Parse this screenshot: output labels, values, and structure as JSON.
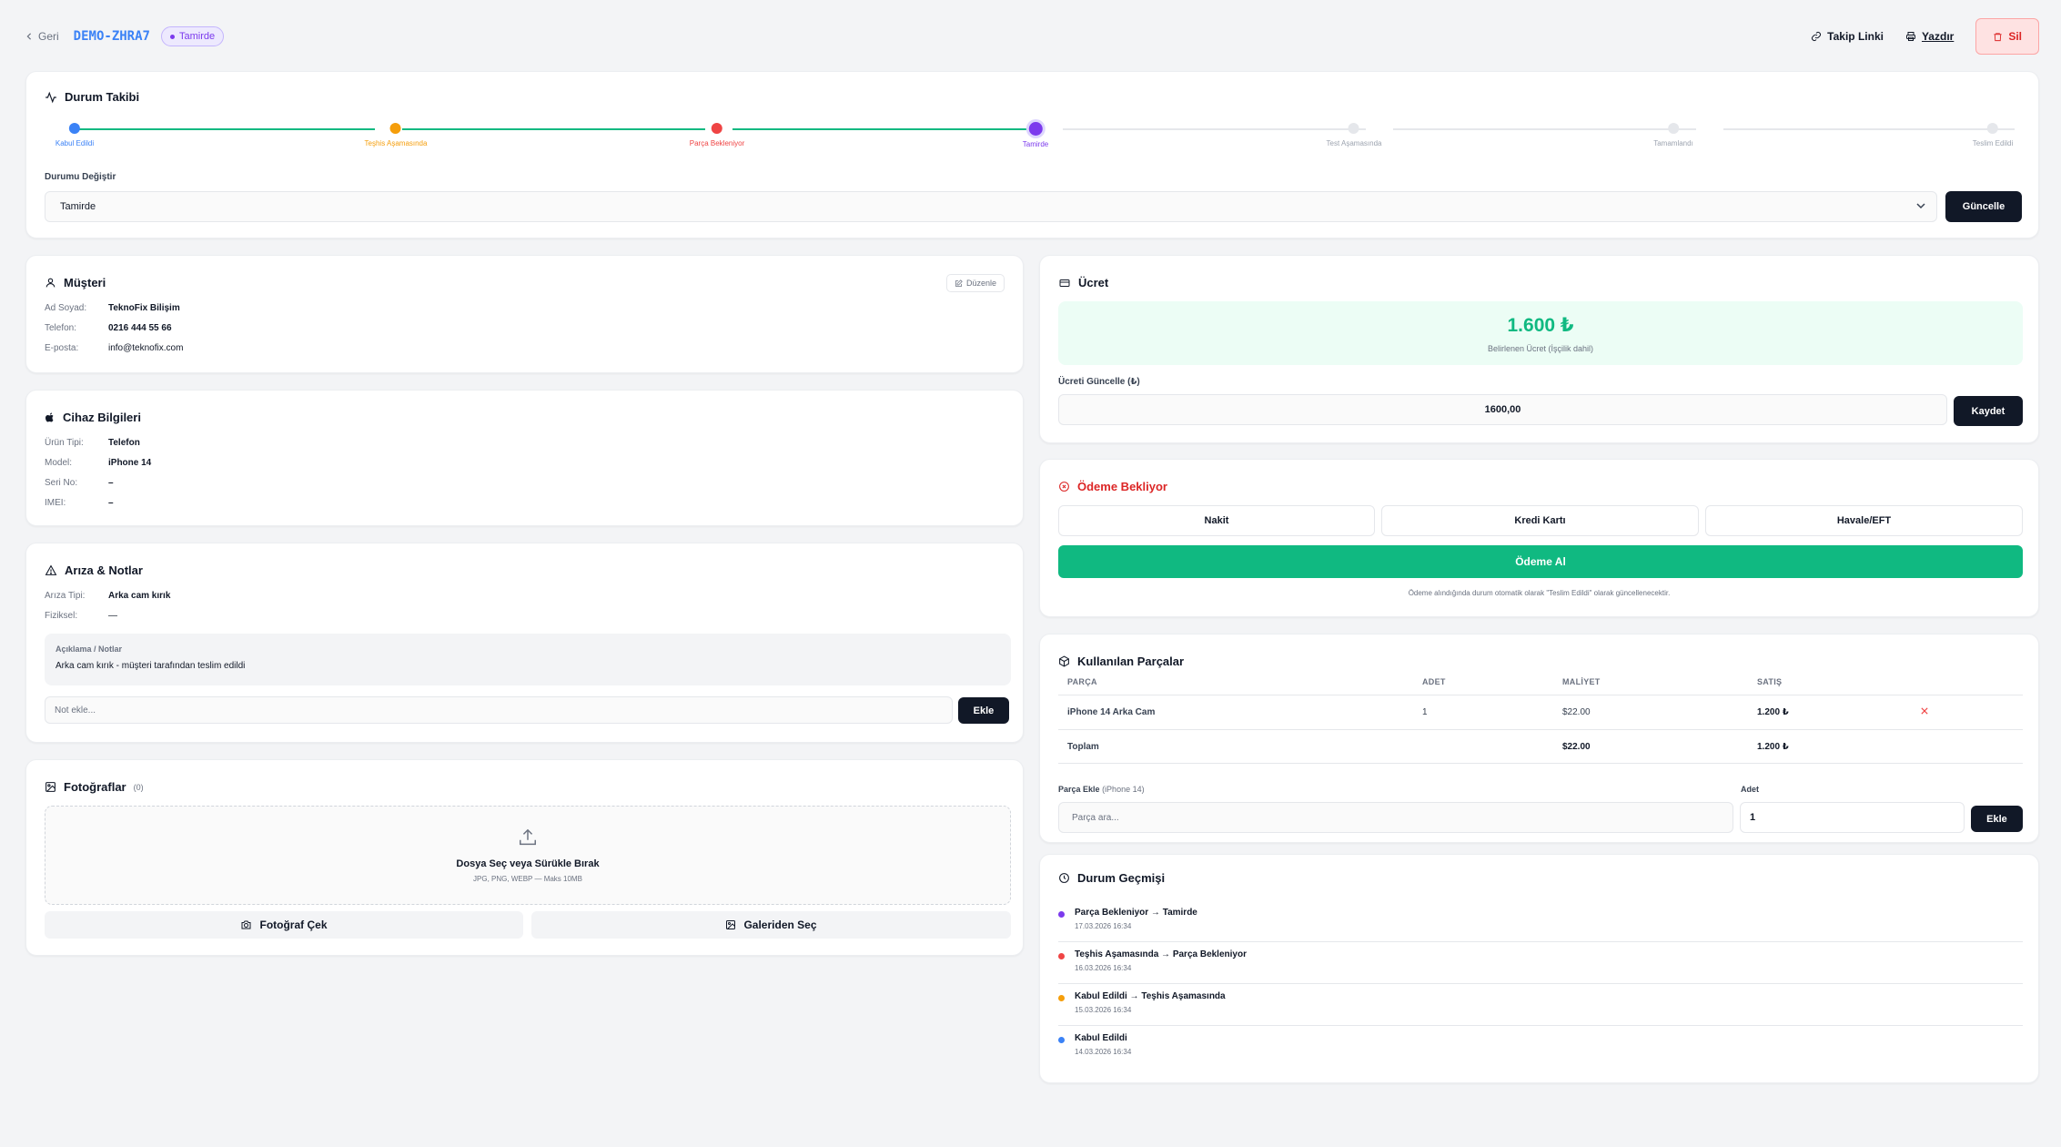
{
  "header": {
    "back_label": "Geri",
    "code": "DEMO-ZHRA7",
    "status_badge": "Tamirde",
    "tracking_link_label": "Takip Linki",
    "print_label": "Yazdır",
    "delete_label": "Sil"
  },
  "status_tracking": {
    "title": "Durum Takibi",
    "steps": [
      {
        "label": "Kabul Edildi",
        "color": "#3b82f6"
      },
      {
        "label": "Teşhis Aşamasında",
        "color": "#f59e0b"
      },
      {
        "label": "Parça Bekleniyor",
        "color": "#ef4444"
      },
      {
        "label": "Tamirde",
        "color": "#7c3aed"
      },
      {
        "label": "Test Aşamasında",
        "color": "#9ca3af"
      },
      {
        "label": "Tamamlandı",
        "color": "#9ca3af"
      },
      {
        "label": "Teslim Edildi",
        "color": "#9ca3af"
      }
    ],
    "change_label": "Durumu Değiştir",
    "selected_status": "Tamirde",
    "update_button": "Güncelle"
  },
  "customer": {
    "title": "Müşteri",
    "edit_label": "Düzenle",
    "fields": [
      {
        "key": "Ad Soyad:",
        "value": "TeknoFix Bilişim"
      },
      {
        "key": "Telefon:",
        "value": "0216 444 55 66"
      },
      {
        "key": "E-posta:",
        "value": "info@teknofix.com"
      }
    ]
  },
  "device": {
    "title": "Cihaz Bilgileri",
    "fields": [
      {
        "key": "Ürün Tipi:",
        "value": "Telefon"
      },
      {
        "key": "Model:",
        "value": "iPhone 14"
      },
      {
        "key": "Seri No:",
        "value": "–"
      },
      {
        "key": "IMEI:",
        "value": "–"
      }
    ]
  },
  "fault": {
    "title": "Arıza & Notlar",
    "fields": [
      {
        "key": "Arıza Tipi:",
        "value": "Arka cam kırık"
      },
      {
        "key": "Fiziksel:",
        "value": "—"
      }
    ],
    "notes_title": "Açıklama / Notlar",
    "notes_text": "Arka cam kırık - müşteri tarafından teslim edildi",
    "note_placeholder": "Not ekle...",
    "add_button": "Ekle"
  },
  "photos": {
    "title": "Fotoğraflar",
    "count": "(0)",
    "drop_title": "Dosya Seç veya Sürükle Bırak",
    "drop_sub": "JPG, PNG, WEBP — Maks 10MB",
    "camera_button": "Fotoğraf Çek",
    "gallery_button": "Galeriden Seç"
  },
  "fee": {
    "title": "Ücret",
    "amount": "1.600 ₺",
    "amount_sub": "Belirlenen Ücret (İşçilik dahil)",
    "update_label": "Ücreti Güncelle (₺)",
    "input_value": "1600,00",
    "save_button": "Kaydet"
  },
  "payment": {
    "title": "Ödeme Bekliyor",
    "methods": [
      "Nakit",
      "Kredi Kartı",
      "Havale/EFT"
    ],
    "pay_button": "Ödeme Al",
    "note": "Ödeme alındığında durum otomatik olarak \"Teslim Edildi\" olarak güncellenecektir."
  },
  "parts": {
    "title": "Kullanılan Parçalar",
    "columns": [
      "PARÇA",
      "ADET",
      "MALİYET",
      "SATIŞ"
    ],
    "rows": [
      {
        "name": "iPhone 14 Arka Cam",
        "qty": "1",
        "cost": "$22.00",
        "sale": "1.200 ₺"
      }
    ],
    "total": {
      "label": "Toplam",
      "cost": "$22.00",
      "sale": "1.200 ₺"
    },
    "add_label": "Parça Ekle",
    "add_model": "(iPhone 14)",
    "qty_label": "Adet",
    "search_placeholder": "Parça ara...",
    "qty_value": "1",
    "add_button": "Ekle"
  },
  "history": {
    "title": "Durum Geçmişi",
    "items": [
      {
        "text": "Parça Bekleniyor → Tamirde",
        "date": "17.03.2026 16:34",
        "color": "#7c3aed"
      },
      {
        "text": "Teşhis Aşamasında → Parça Bekleniyor",
        "date": "16.03.2026 16:34",
        "color": "#ef4444"
      },
      {
        "text": "Kabul Edildi → Teşhis Aşamasında",
        "date": "15.03.2026 16:34",
        "color": "#f59e0b"
      },
      {
        "text": "Kabul Edildi",
        "date": "14.03.2026 16:34",
        "color": "#3b82f6"
      }
    ]
  }
}
